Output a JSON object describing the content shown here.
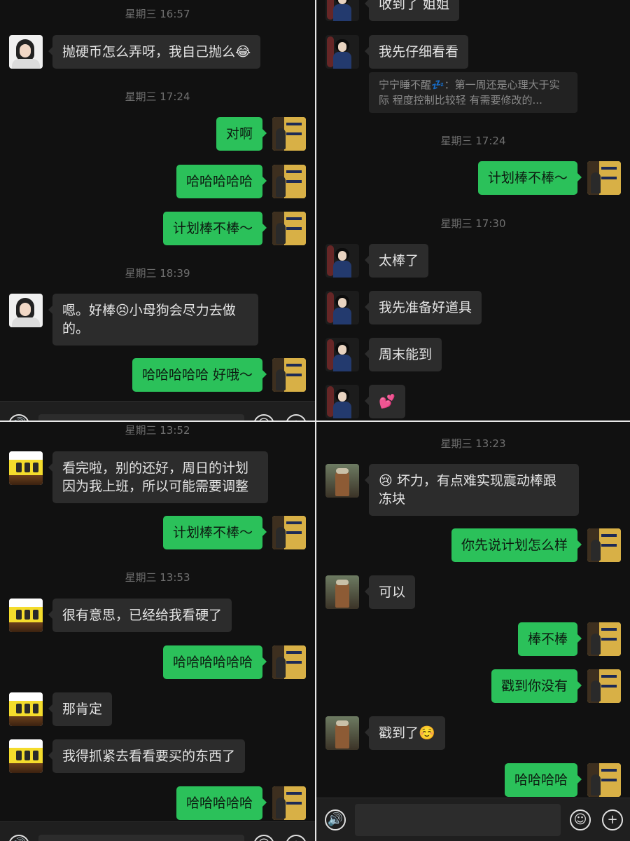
{
  "panel_top_left": {
    "messages": [
      {
        "type": "time",
        "text": "星期三 16:57"
      },
      {
        "type": "in",
        "avatar": "girl-avatar",
        "text": "抛硬币怎么弄呀，我自己抛么😂"
      },
      {
        "type": "time",
        "text": "星期三 17:24"
      },
      {
        "type": "out",
        "text": "对啊"
      },
      {
        "type": "out",
        "text": "哈哈哈哈哈"
      },
      {
        "type": "out",
        "text": "计划棒不棒～"
      },
      {
        "type": "time",
        "text": "星期三 18:39"
      },
      {
        "type": "in",
        "avatar": "girl-avatar",
        "text": "嗯。好棒😣小母狗会尽力去做的。"
      },
      {
        "type": "out",
        "text": "哈哈哈哈哈 好哦～"
      }
    ]
  },
  "panel_top_right": {
    "messages": [
      {
        "type": "in",
        "avatar": "dark-avatar",
        "text": "收到了 姐姐"
      },
      {
        "type": "in",
        "avatar": "dark-avatar",
        "text": "我先仔细看看"
      },
      {
        "type": "quote",
        "text": "宁宁睡不醒💤：第一周还是心理大于实际 程度控制比较轻 有需要修改的..."
      },
      {
        "type": "time",
        "text": "星期三 17:24"
      },
      {
        "type": "out",
        "text": "计划棒不棒～"
      },
      {
        "type": "time",
        "text": "星期三 17:30"
      },
      {
        "type": "in",
        "avatar": "dark-avatar",
        "text": "太棒了"
      },
      {
        "type": "in",
        "avatar": "dark-avatar",
        "text": "我先准备好道具"
      },
      {
        "type": "in",
        "avatar": "dark-avatar",
        "text": "周末能到"
      },
      {
        "type": "in",
        "avatar": "dark-avatar",
        "text": "💕"
      }
    ]
  },
  "panel_bottom_left": {
    "messages": [
      {
        "type": "time",
        "text": "星期三 13:52"
      },
      {
        "type": "in",
        "avatar": "scroll-avatar",
        "text": "看完啦，别的还好，周日的计划因为我上班，所以可能需要调整"
      },
      {
        "type": "out",
        "text": "计划棒不棒～"
      },
      {
        "type": "time",
        "text": "星期三 13:53"
      },
      {
        "type": "in",
        "avatar": "scroll-avatar",
        "text": "很有意思，已经给我看硬了"
      },
      {
        "type": "out",
        "text": "哈哈哈哈哈哈"
      },
      {
        "type": "in",
        "avatar": "scroll-avatar",
        "text": "那肯定"
      },
      {
        "type": "in",
        "avatar": "scroll-avatar",
        "text": "我得抓紧去看看要买的东西了"
      },
      {
        "type": "out",
        "text": "哈哈哈哈哈"
      }
    ]
  },
  "panel_bottom_right": {
    "messages": [
      {
        "type": "time",
        "text": "星期三 13:23"
      },
      {
        "type": "in",
        "avatar": "soldier-avatar",
        "text": "😢 坏力，有点难实现震动棒跟冻块"
      },
      {
        "type": "out",
        "text": "你先说计划怎么样"
      },
      {
        "type": "in",
        "avatar": "soldier-avatar",
        "text": "可以"
      },
      {
        "type": "out",
        "text": "棒不棒"
      },
      {
        "type": "out",
        "text": "戳到你没有"
      },
      {
        "type": "in",
        "avatar": "soldier-avatar",
        "text": "戳到了☺️"
      },
      {
        "type": "out",
        "text": "哈哈哈哈"
      }
    ]
  },
  "input_bar": {
    "voice_icon": "voice-icon",
    "emoji_icon": "emoji-icon",
    "plus_icon": "plus-icon",
    "voice_glyph": "🔊",
    "emoji_glyph": "☺",
    "plus_glyph": "+"
  },
  "colors": {
    "background": "#111111",
    "incoming_bubble": "#2c2c2c",
    "outgoing_bubble": "#2bc15a",
    "timestamp": "#6f6f6f"
  }
}
